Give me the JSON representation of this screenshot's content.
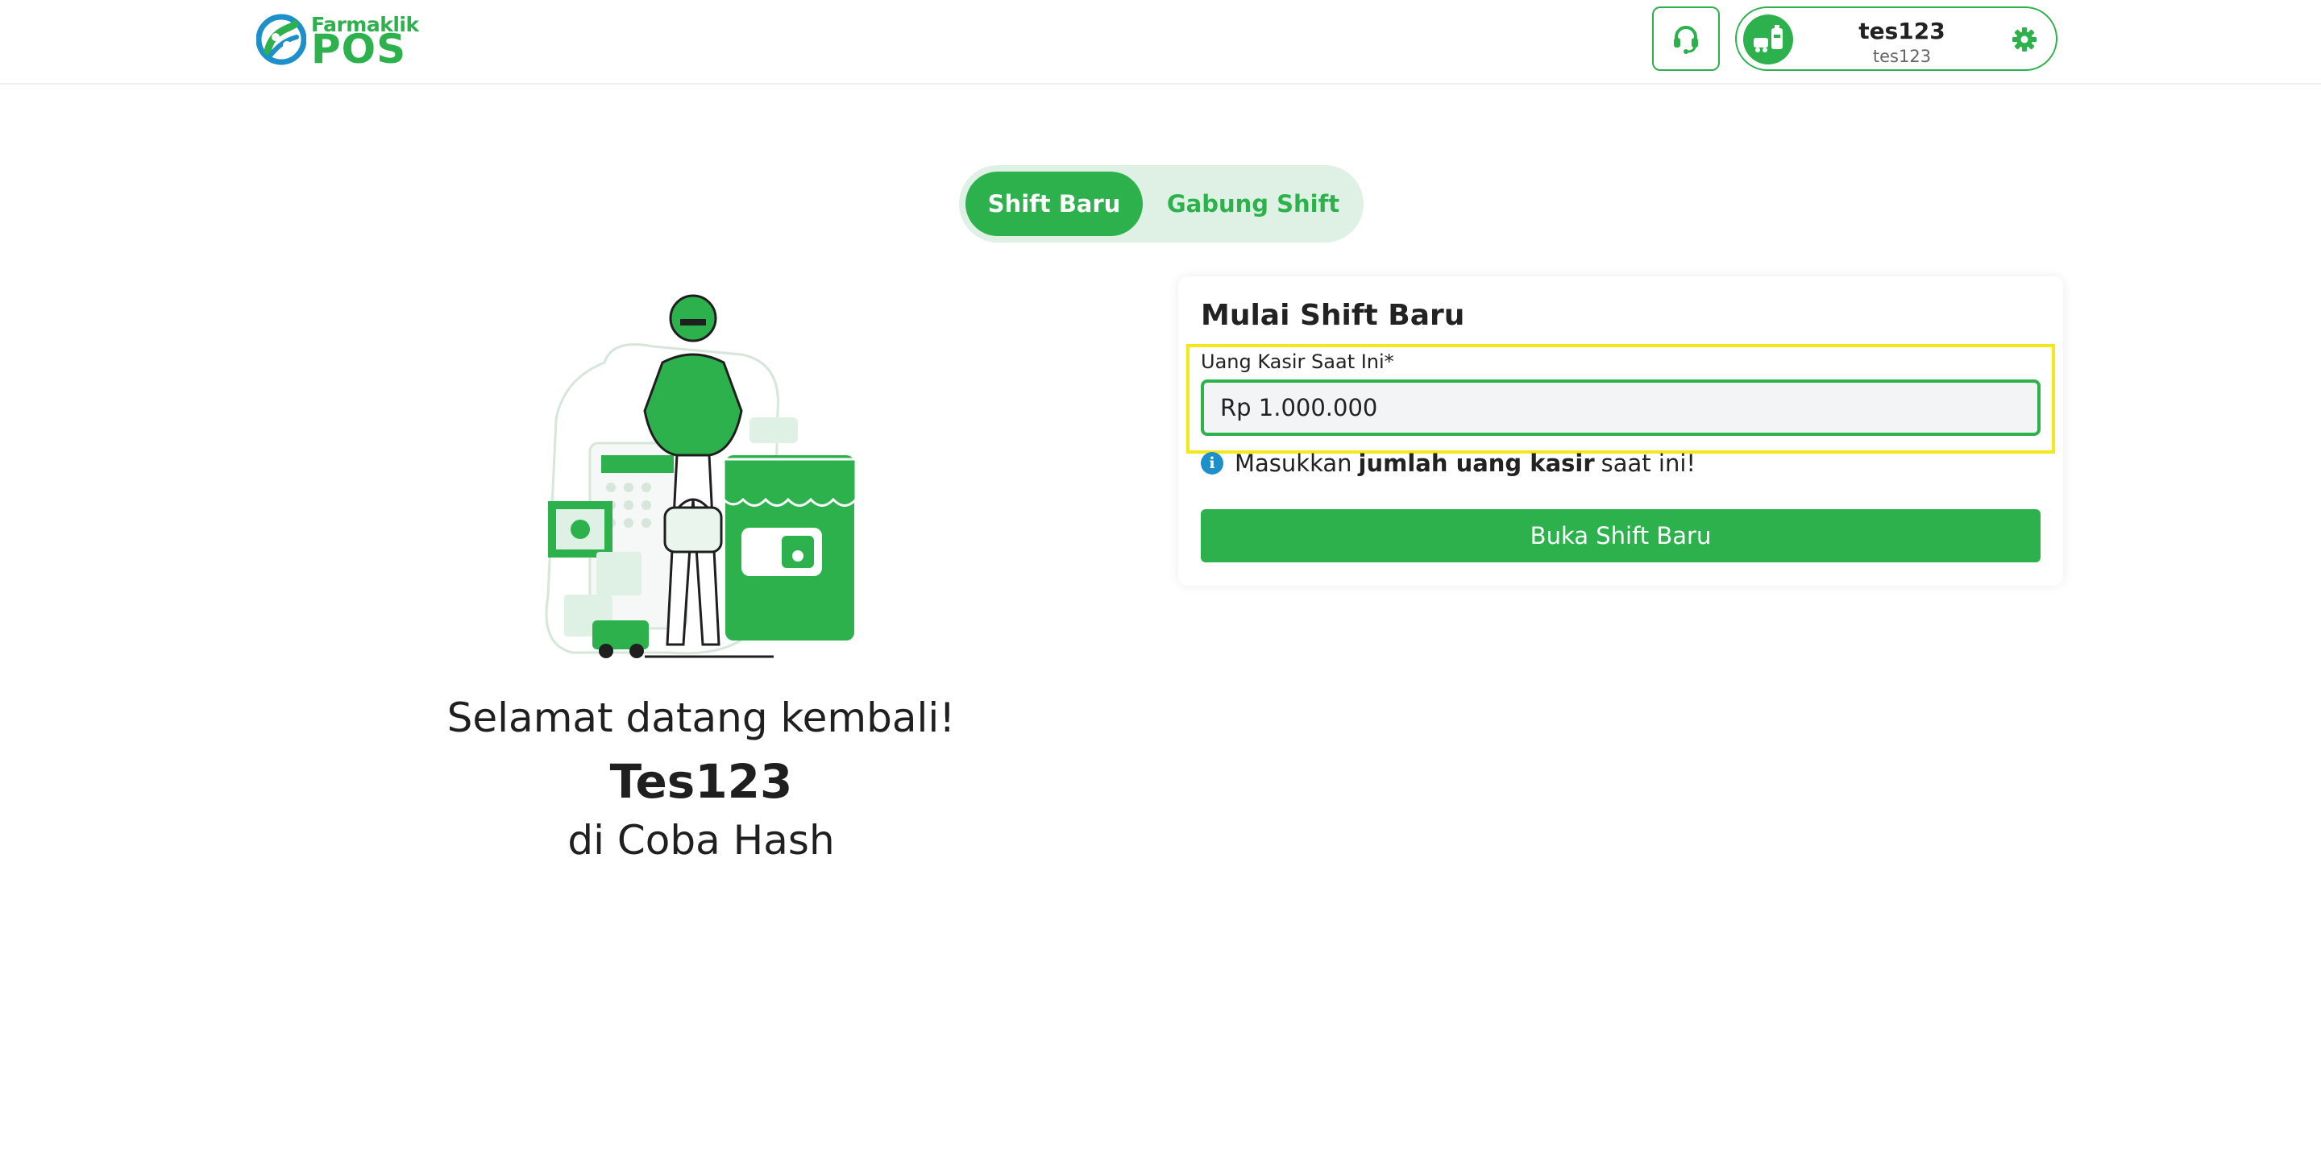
{
  "header": {
    "logo_top": "Farmaklik",
    "logo_main": "POS",
    "user_name": "tes123",
    "user_id": "tes123"
  },
  "tabs": [
    {
      "label": "Shift Baru",
      "active": true
    },
    {
      "label": "Gabung Shift",
      "active": false
    }
  ],
  "welcome": {
    "line1": "Selamat datang kembali!",
    "name": "Tes123",
    "line3": "di Coba Hash"
  },
  "card": {
    "title": "Mulai Shift Baru",
    "field_label": "Uang Kasir Saat Ini*",
    "field_value": "Rp 1.000.000",
    "hint_before": "Masukkan",
    "hint_bold": "jumlah uang kasir",
    "hint_after": "saat ini!",
    "button_label": "Buka Shift Baru"
  },
  "colors": {
    "brand_green": "#2db14c",
    "light_green": "#dff1e4",
    "info_blue": "#1e90c9",
    "highlight_yellow": "#f3e81a"
  },
  "icons": [
    "headset-icon",
    "pharmacy-avatar-icon",
    "gear-icon",
    "info-icon",
    "logo-mark-icon"
  ]
}
